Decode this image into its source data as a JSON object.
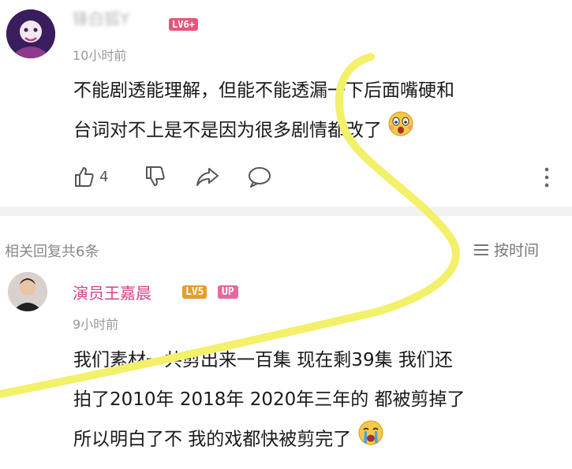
{
  "comment": {
    "username": "锋白狐Y",
    "level_badge": "LV6+",
    "time": "10小时前",
    "text_line1": "不能剧透能理解，但能不能透漏一下后面嘴硬和",
    "text_line2": "台词对不上是不是因为很多剧情都改了",
    "like_count": "4"
  },
  "replies_bar": {
    "count_label": "相关回复共6条",
    "sort_label": "按时间"
  },
  "reply": {
    "username": "演员王嘉晨",
    "level_badge": "LV5",
    "up_badge": "UP",
    "time": "9小时前",
    "text_line1": "我们素材一共剪出来一百集 现在剩39集 我们还",
    "text_line2": "拍了2010年 2018年 2020年三年的 都被剪掉了",
    "text_line3": "所以明白了不 我的戏都快被剪完了"
  },
  "colors": {
    "reply_name": "#d6428a",
    "overlay_highlight": "#f3f06a"
  },
  "icons": [
    "like-icon",
    "dislike-icon",
    "share-icon",
    "comment-icon",
    "more-icon",
    "sort-icon",
    "shocked-emoji-icon",
    "crying-emoji-icon"
  ]
}
